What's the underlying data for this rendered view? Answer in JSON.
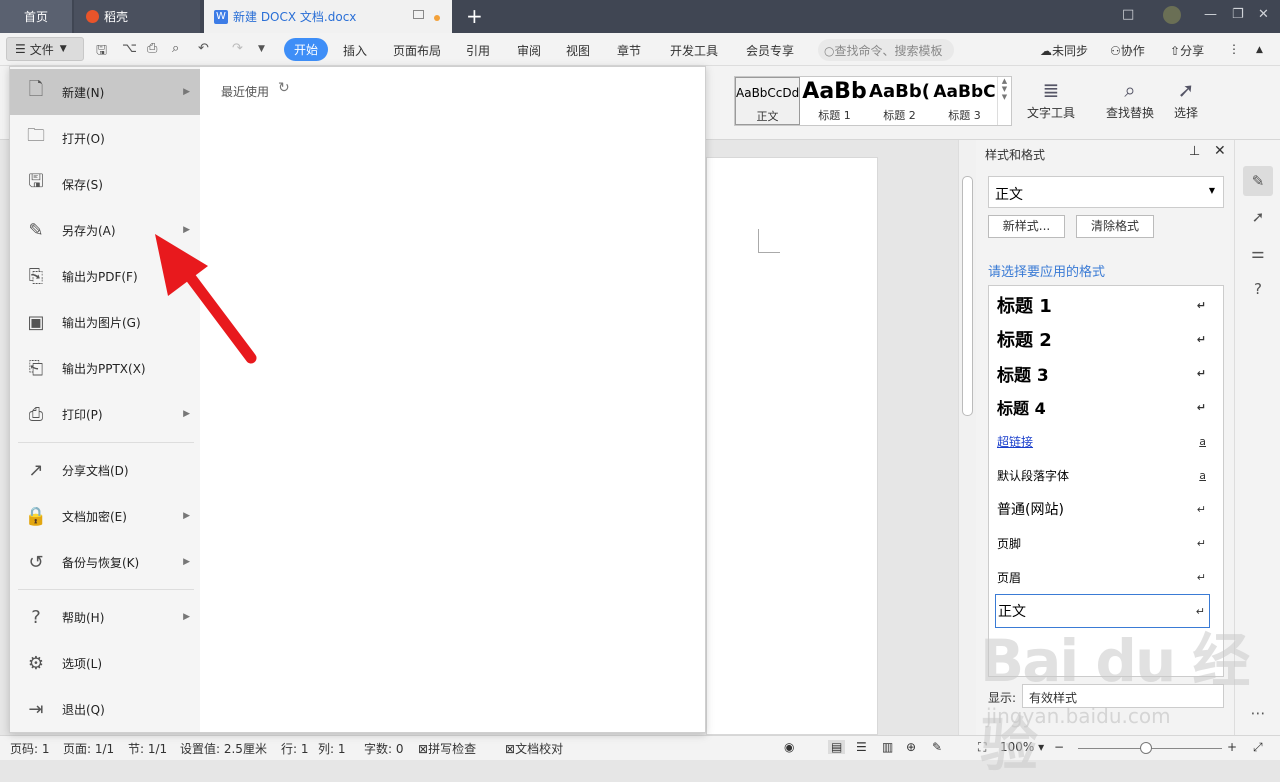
{
  "titlebar": {
    "tabs": {
      "home": "首页",
      "daoke": "稻壳",
      "doc": "新建 DOCX 文档.docx"
    },
    "doc_logo": "W",
    "new_tab": "+",
    "window_controls": [
      "□",
      "—",
      "❐",
      "✕"
    ]
  },
  "toolbar": {
    "file": "文件",
    "quick_icons": [
      "save-icon",
      "undo-icon",
      "print-icon",
      "preview-icon",
      "redo-icon"
    ],
    "ribbon_tabs": [
      "开始",
      "插入",
      "页面布局",
      "引用",
      "审阅",
      "视图",
      "章节",
      "开发工具",
      "会员专享"
    ],
    "active_tab": "开始",
    "search_placeholder": "查找命令、搜索模板",
    "right": {
      "sync": "未同步",
      "collab": "协作",
      "share": "分享"
    }
  },
  "ribbon": {
    "styles": [
      {
        "sample": "AaBbCcDd",
        "label": "正文"
      },
      {
        "sample": "AaBb",
        "label": "标题 1"
      },
      {
        "sample": "AaBb(",
        "label": "标题 2"
      },
      {
        "sample": "AaBbC",
        "label": "标题 3"
      }
    ],
    "text_tools": "文字工具",
    "find_replace": "查找替换",
    "select": "选择"
  },
  "file_menu": {
    "recent_title": "最近使用",
    "items": [
      {
        "label": "新建(N)",
        "icon": "new-file-icon",
        "glyph": "🗋",
        "has_sub": true
      },
      {
        "label": "打开(O)",
        "icon": "folder-icon",
        "glyph": "🗀",
        "has_sub": false
      },
      {
        "label": "保存(S)",
        "icon": "save-icon",
        "glyph": "🖫",
        "has_sub": false
      },
      {
        "label": "另存为(A)",
        "icon": "save-as-icon",
        "glyph": "✎",
        "has_sub": true
      },
      {
        "label": "输出为PDF(F)",
        "icon": "pdf-icon",
        "glyph": "⎘",
        "has_sub": false
      },
      {
        "label": "输出为图片(G)",
        "icon": "image-icon",
        "glyph": "▣",
        "has_sub": false
      },
      {
        "label": "输出为PPTX(X)",
        "icon": "pptx-icon",
        "glyph": "⎗",
        "has_sub": false
      },
      {
        "label": "打印(P)",
        "icon": "printer-icon",
        "glyph": "⎙",
        "has_sub": true
      },
      {
        "label": "分享文档(D)",
        "icon": "share-icon",
        "glyph": "↗",
        "has_sub": false
      },
      {
        "label": "文档加密(E)",
        "icon": "lock-doc-icon",
        "glyph": "🔒",
        "has_sub": true
      },
      {
        "label": "备份与恢复(K)",
        "icon": "backup-icon",
        "glyph": "↺",
        "has_sub": true
      },
      {
        "label": "帮助(H)",
        "icon": "help-icon",
        "glyph": "?",
        "has_sub": true
      },
      {
        "label": "选项(L)",
        "icon": "gear-icon",
        "glyph": "⚙",
        "has_sub": false
      },
      {
        "label": "退出(Q)",
        "icon": "exit-icon",
        "glyph": "⇥",
        "has_sub": false
      }
    ]
  },
  "styles_panel": {
    "title": "样式和格式",
    "current": "正文",
    "new_style": "新样式...",
    "clear_format": "清除格式",
    "apply_label": "请选择要应用的格式",
    "list": [
      "标题 1",
      "标题 2",
      "标题 3",
      "标题 4",
      "超链接",
      "默认段落字体",
      "普通(网站)",
      "页脚",
      "页眉",
      "正文"
    ],
    "show_label": "显示:",
    "show_value": "有效样式"
  },
  "statusbar": {
    "page_num": "页码: 1",
    "page": "页面: 1/1",
    "section": "节: 1/1",
    "setting": "设置值: 2.5厘米",
    "row": "行: 1",
    "col": "列: 1",
    "words": "字数: 0",
    "spell": "拼写检查",
    "proof": "文档校对",
    "zoom": "100%"
  },
  "watermark": {
    "logo": "Bai du 经验",
    "url": "jingyan.baidu.com"
  },
  "colors": {
    "accent": "#3e8ef7",
    "arrow": "#e8191d",
    "titlebar": "#404653"
  }
}
